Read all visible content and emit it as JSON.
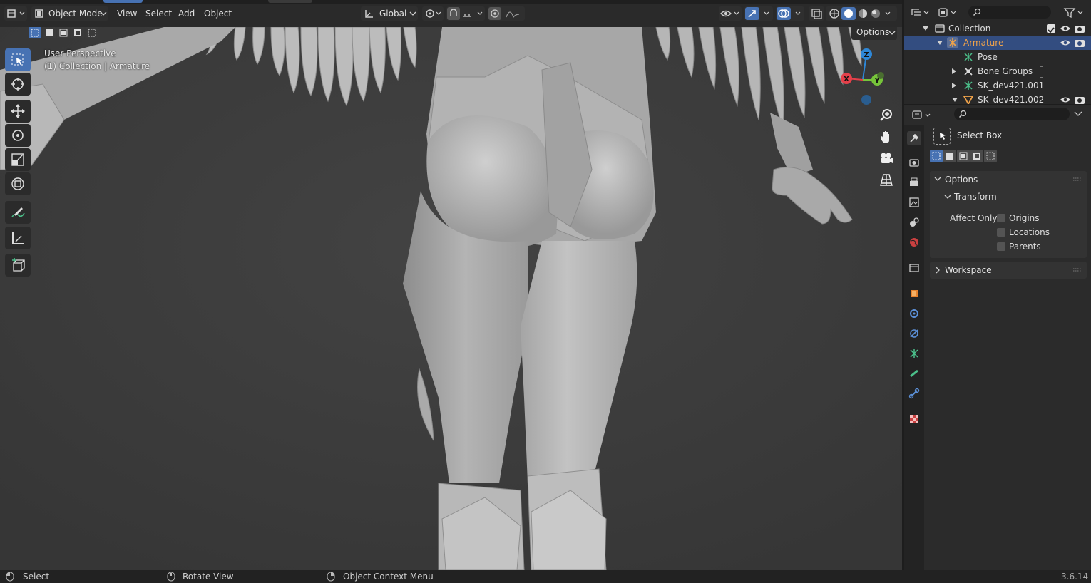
{
  "header": {
    "mode_label": "Object Mode",
    "menu": [
      "View",
      "Select",
      "Add",
      "Object"
    ],
    "orientation_label": "Global",
    "options_label": "Options"
  },
  "viewport": {
    "view_name": "User Perspective",
    "view_context": "(1) Collection | Armature",
    "gizmo_axes": {
      "x": "X",
      "y": "Y",
      "z": "Z"
    }
  },
  "outliner": {
    "rows": [
      {
        "label": "Collection"
      },
      {
        "label": "Armature"
      },
      {
        "label": "Pose"
      },
      {
        "label": "Bone Groups"
      },
      {
        "label": "SK_dev421.001"
      },
      {
        "label": "SK_dev421.002"
      }
    ]
  },
  "properties": {
    "tool_name": "Select Box",
    "options_header": "Options",
    "transform_header": "Transform",
    "affect_only_label": "Affect Only",
    "checkboxes": [
      {
        "label": "Origins",
        "checked": false
      },
      {
        "label": "Locations",
        "checked": false
      },
      {
        "label": "Parents",
        "checked": false
      }
    ],
    "workspace_header": "Workspace"
  },
  "status": {
    "select": "Select",
    "rotate": "Rotate View",
    "context": "Object Context Menu",
    "version": "3.6.14"
  },
  "colors": {
    "accent": "#4772b3",
    "viewport_bg": "#3d3d3d",
    "axis_x": "#e5404a",
    "axis_y": "#76c43a",
    "axis_z": "#2e87d7",
    "armature_text": "#f0a34a"
  }
}
